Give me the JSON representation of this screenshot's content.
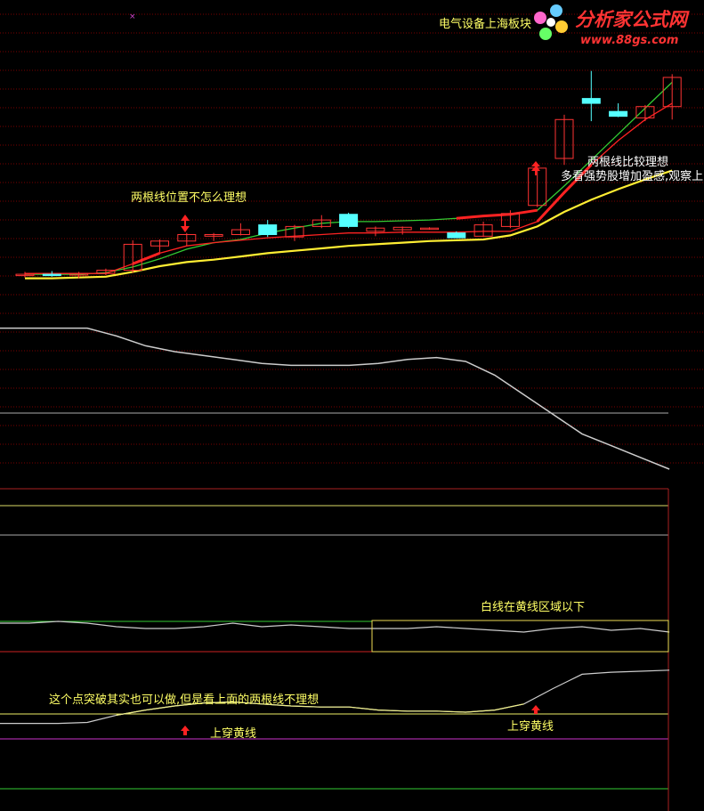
{
  "watermark": {
    "title": "分析家公式网",
    "url": "www.88gs.com"
  },
  "sector_label": "电气设备上海板块",
  "annotations": {
    "price_bad": "两根线位置不怎么理想",
    "price_good": "两根线比较理想",
    "price_good_2": "多看强势股增加盈感,观察上",
    "osc_box": "白线在黄线区域以下",
    "lower_note": "这个点突破其实也可以做,但是看上面的两根线不理想",
    "cross1": "上穿黄线",
    "cross2": "上穿黄线"
  },
  "colors": {
    "background": "#000000",
    "candle_up": "#FF3333",
    "candle_down": "#55FFFF",
    "ma_green": "#33CC33",
    "ma_red": "#FF2222",
    "ma_yellow": "#FFEE33",
    "white_line": "#CCCCCC",
    "grid": "#7A0000",
    "arrow": "#FF2222"
  },
  "chart_data": {
    "type": "line",
    "panels": [
      {
        "name": "price",
        "candles": [
          {
            "o": 100.0,
            "h": 100.4,
            "l": 99.7,
            "c": 100.1
          },
          {
            "o": 100.1,
            "h": 100.5,
            "l": 99.8,
            "c": 100.0
          },
          {
            "o": 100.0,
            "h": 100.4,
            "l": 99.6,
            "c": 100.2
          },
          {
            "o": 100.2,
            "h": 100.8,
            "l": 100.0,
            "c": 100.6
          },
          {
            "o": 100.6,
            "h": 104.3,
            "l": 100.3,
            "c": 103.8
          },
          {
            "o": 103.6,
            "h": 104.4,
            "l": 102.8,
            "c": 104.2
          },
          {
            "o": 104.2,
            "h": 105.2,
            "l": 103.6,
            "c": 105.0
          },
          {
            "o": 104.8,
            "h": 105.2,
            "l": 104.2,
            "c": 105.0
          },
          {
            "o": 105.0,
            "h": 106.4,
            "l": 104.9,
            "c": 105.6
          },
          {
            "o": 106.2,
            "h": 106.8,
            "l": 104.7,
            "c": 105.0
          },
          {
            "o": 104.7,
            "h": 106.2,
            "l": 104.2,
            "c": 106.0
          },
          {
            "o": 106.0,
            "h": 107.4,
            "l": 105.8,
            "c": 106.8
          },
          {
            "o": 107.5,
            "h": 107.7,
            "l": 105.8,
            "c": 106.0
          },
          {
            "o": 105.4,
            "h": 106.0,
            "l": 104.8,
            "c": 105.8
          },
          {
            "o": 105.6,
            "h": 106.0,
            "l": 105.0,
            "c": 105.9
          },
          {
            "o": 105.8,
            "h": 105.9,
            "l": 105.6,
            "c": 105.8
          },
          {
            "o": 105.2,
            "h": 105.4,
            "l": 104.6,
            "c": 104.6
          },
          {
            "o": 104.8,
            "h": 106.6,
            "l": 104.7,
            "c": 106.2
          },
          {
            "o": 106.0,
            "h": 108.0,
            "l": 105.8,
            "c": 107.6
          },
          {
            "o": 108.6,
            "h": 113.6,
            "l": 108.4,
            "c": 113.2
          },
          {
            "o": 114.4,
            "h": 119.8,
            "l": 113.6,
            "c": 119.2
          },
          {
            "o": 121.8,
            "h": 125.2,
            "l": 119.0,
            "c": 121.2
          },
          {
            "o": 120.2,
            "h": 121.2,
            "l": 119.5,
            "c": 119.6
          },
          {
            "o": 119.4,
            "h": 121.0,
            "l": 119.0,
            "c": 120.8
          },
          {
            "o": 120.8,
            "h": 124.8,
            "l": 119.2,
            "c": 124.4
          }
        ],
        "ma_green": [
          100.1,
          100.1,
          100.1,
          100.3,
          101.0,
          102.0,
          103.2,
          104.0,
          104.4,
          105.2,
          105.8,
          106.4,
          106.6,
          106.6,
          106.7,
          106.8,
          107.0,
          107.3,
          107.5,
          108.0,
          111.0,
          114.2,
          117.4,
          120.6,
          123.8
        ],
        "ma_red": [
          100.2,
          100.2,
          100.2,
          100.2,
          101.4,
          102.7,
          103.6,
          104.0,
          104.3,
          104.6,
          104.8,
          105.0,
          105.2,
          105.2,
          105.3,
          105.3,
          105.3,
          105.4,
          105.4,
          106.6,
          110.2,
          113.6,
          116.6,
          119.2,
          121.2
        ],
        "ma_yellow": [
          99.6,
          99.6,
          99.7,
          99.8,
          100.4,
          101.1,
          101.6,
          101.9,
          102.3,
          102.7,
          103.0,
          103.3,
          103.6,
          103.8,
          104.0,
          104.2,
          104.3,
          104.4,
          104.9,
          106.0,
          107.8,
          109.3,
          110.6,
          111.8,
          112.9
        ]
      },
      {
        "name": "trend",
        "white": [
          72,
          72,
          72,
          72,
          68,
          63,
          60,
          58,
          56,
          54,
          53,
          53,
          53,
          54,
          56,
          57,
          55,
          48,
          38,
          28,
          18,
          12,
          6,
          0
        ]
      },
      {
        "name": "oscillator",
        "white": [
          55,
          55,
          56,
          55,
          53,
          52,
          52,
          53,
          55,
          53,
          54,
          53,
          52,
          52,
          52,
          53,
          52,
          51,
          50,
          52,
          53,
          51,
          52,
          50
        ],
        "green_level": 56,
        "red_level": 44
      },
      {
        "name": "momentum",
        "white": [
          36,
          36,
          36,
          37,
          44,
          49,
          53,
          56,
          57,
          55,
          53,
          52,
          52,
          49,
          48,
          48,
          47,
          49,
          55,
          70,
          84,
          86,
          87,
          88
        ],
        "yellow_level": 46,
        "magenta_level": 25
      }
    ]
  }
}
